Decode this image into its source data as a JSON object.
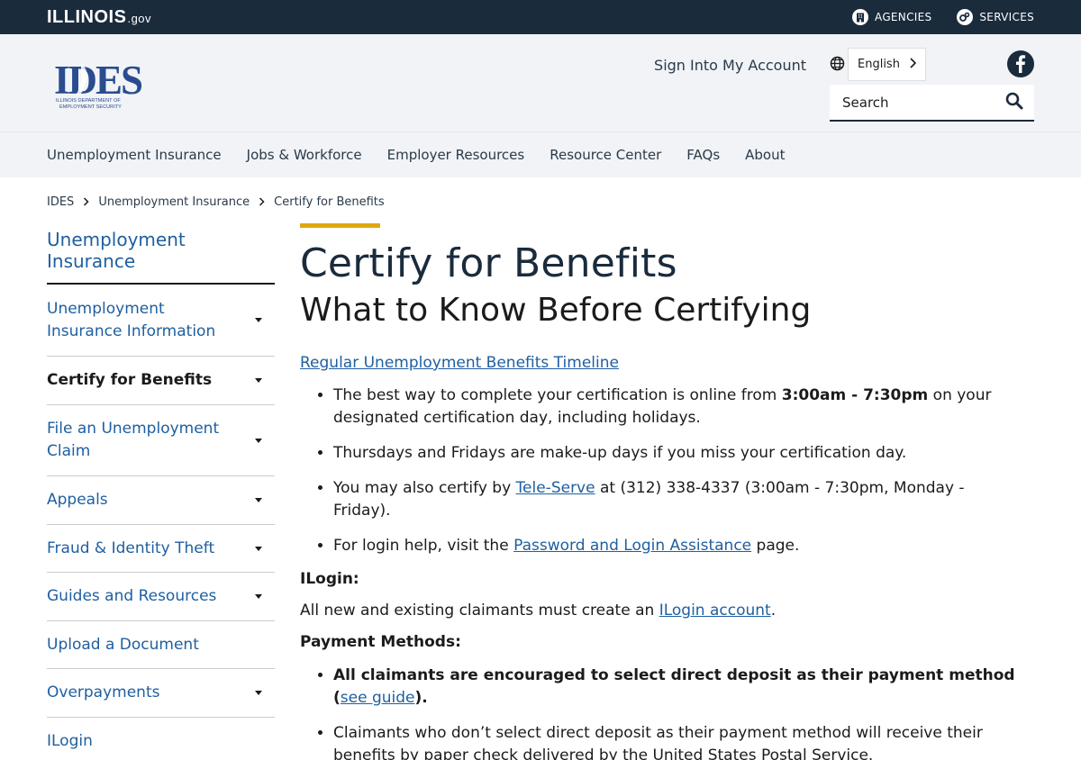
{
  "topbar": {
    "brand": "ILLINOIS",
    "brand_suffix": ".gov",
    "agencies": "AGENCIES",
    "services": "SERVICES"
  },
  "header": {
    "logo_text": "IDES",
    "logo_subtext": "ILLINOIS DEPARTMENT OF EMPLOYMENT SECURITY",
    "sign_in": "Sign Into My Account",
    "language": "English",
    "search_placeholder": "Search"
  },
  "nav": [
    "Unemployment Insurance",
    "Jobs & Workforce",
    "Employer Resources",
    "Resource Center",
    "FAQs",
    "About"
  ],
  "breadcrumb": [
    "IDES",
    "Unemployment Insurance",
    "Certify for Benefits"
  ],
  "sidebar": {
    "title": "Unemployment Insurance",
    "items": [
      {
        "label": "Unemployment Insurance Information",
        "has_dropdown": true
      },
      {
        "label": "Certify for Benefits",
        "has_dropdown": true,
        "active": true
      },
      {
        "label": "File an Unemployment Claim",
        "has_dropdown": true
      },
      {
        "label": "Appeals",
        "has_dropdown": true
      },
      {
        "label": "Fraud & Identity Theft",
        "has_dropdown": true
      },
      {
        "label": "Guides and Resources",
        "has_dropdown": true
      },
      {
        "label": "Upload a Document",
        "has_dropdown": false
      },
      {
        "label": "Overpayments",
        "has_dropdown": true
      },
      {
        "label": "ILogin",
        "has_dropdown": false
      }
    ]
  },
  "content": {
    "title": "Certify for Benefits",
    "subtitle": "What to Know Before Certifying",
    "timeline_link": "Regular Unemployment Benefits Timeline",
    "bullet1_a": "The best way to complete your certification is online from ",
    "bullet1_bold": "3:00am - 7:30pm",
    "bullet1_b": " on your designated certification day, including holidays.",
    "bullet2": "Thursdays and Fridays are make-up days if you miss your certification day.",
    "bullet3_a": "You may also certify by ",
    "bullet3_link": "Tele-Serve",
    "bullet3_b": " at (312) 338-4337 (3:00am - 7:30pm, Monday - Friday).",
    "bullet4_a": "For login help, visit the ",
    "bullet4_link": "Password and Login Assistance",
    "bullet4_b": " page.",
    "ilogin_heading": "ILogin:",
    "ilogin_text_a": "All new and existing claimants must create an ",
    "ilogin_link": "ILogin account",
    "ilogin_text_b": ".",
    "payment_heading": "Payment Methods:",
    "pay1_a": "All claimants are encouraged to select direct deposit as their payment method (",
    "pay1_link": "see guide",
    "pay1_b": ").",
    "pay2": "Claimants who don’t select direct deposit as their payment method will receive their benefits by paper check delivered by the United States Postal Service."
  },
  "colors": {
    "topbar_bg": "#1a2b3c",
    "link": "#1f5fa0",
    "accent": "#e0a80f",
    "header_bg": "#f1f3f6"
  }
}
